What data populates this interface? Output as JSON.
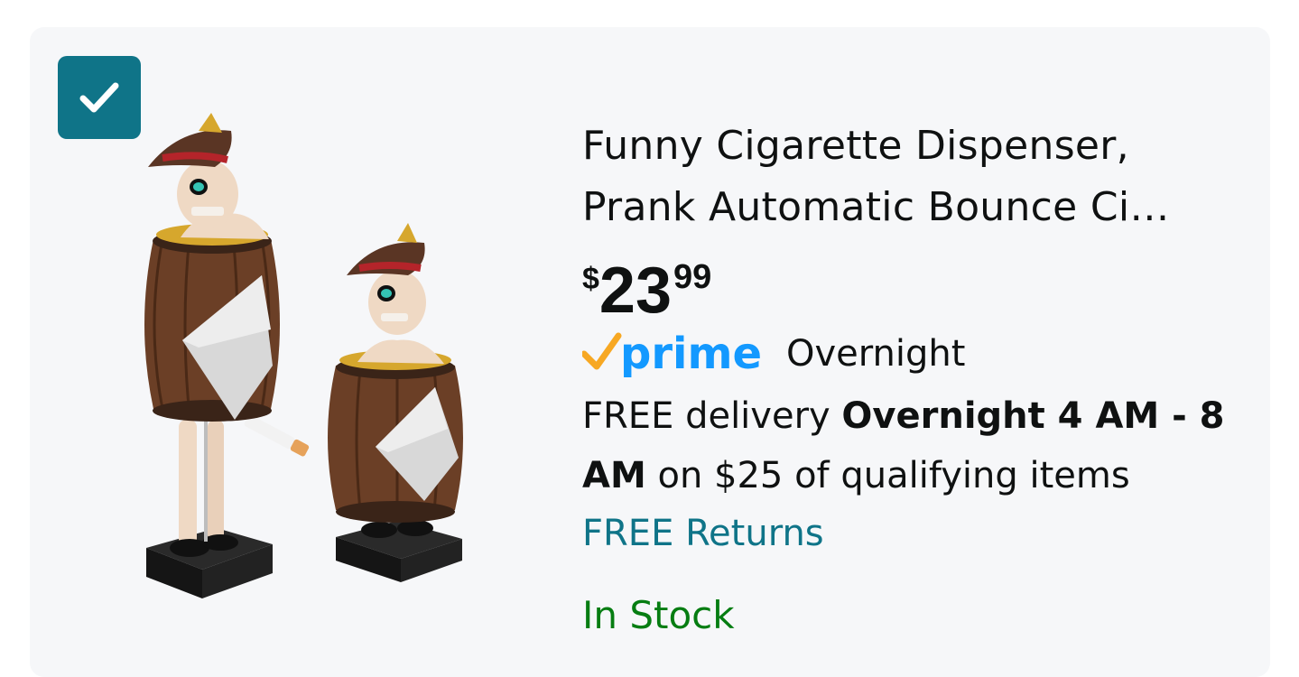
{
  "product": {
    "selected": true,
    "image_alt": "Pirate skeleton in barrel cigarette dispenser, two views",
    "title": "Funny Cigarette Dispenser, Prank Automatic Bounce Ci…",
    "price": {
      "symbol": "$",
      "whole": "23",
      "fraction": "99"
    },
    "prime": {
      "logo_text": "prime",
      "label": "Overnight"
    },
    "delivery": {
      "prefix": "FREE delivery ",
      "window": "Overnight 4 AM - 8 AM",
      "suffix": " on $25 of qualifying items"
    },
    "returns": "FREE Returns",
    "stock": "In Stock"
  },
  "colors": {
    "card_bg": "#f6f7f9",
    "checkbox": "#0f7488",
    "prime_blue": "#1399ff",
    "prime_check": "#f7a823",
    "returns": "#0f7488",
    "stock": "#067d12"
  },
  "icons": {
    "checkbox": "check-icon",
    "prime": "prime-check-icon"
  }
}
